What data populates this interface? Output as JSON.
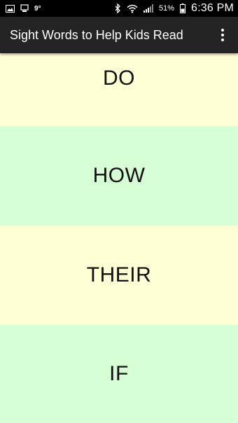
{
  "status_bar": {
    "temperature": "9°",
    "battery_percent": "51%",
    "time": "6:36 PM",
    "icons": [
      "image-notification-icon",
      "download-notification-icon",
      "weather-icon",
      "bluetooth-icon",
      "wifi-icon",
      "signal-icon",
      "battery-icon"
    ]
  },
  "action_bar": {
    "title": "Sight Words to Help Kids Read",
    "menu_icon": "overflow-menu-icon"
  },
  "words": [
    {
      "text": "DO",
      "color": "#ffffd6"
    },
    {
      "text": "HOW",
      "color": "#d6ffd6"
    },
    {
      "text": "THEIR",
      "color": "#ffffd6"
    },
    {
      "text": "IF",
      "color": "#d6ffd6"
    }
  ],
  "colors": {
    "status_bar_bg": "#000000",
    "action_bar_bg": "#242424",
    "card_yellow": "#ffffd6",
    "card_green": "#d6ffd6",
    "word_text": "#111111"
  }
}
